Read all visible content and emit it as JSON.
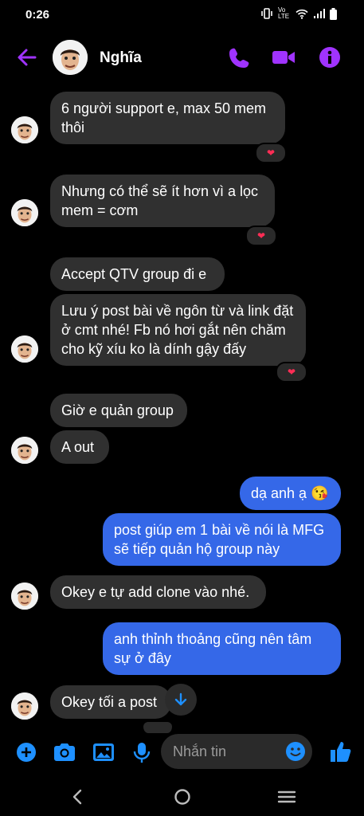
{
  "status": {
    "time": "0:26",
    "network": "Vo LTE"
  },
  "header": {
    "contact_name": "Nghĩa"
  },
  "messages": [
    {
      "text": "6 người support e, max 50 mem thôi"
    },
    {
      "text": "Nhưng có thể sẽ ít hơn vì a lọc mem = cơm"
    },
    {
      "text": "Accept QTV group đi e"
    },
    {
      "text": "Lưu ý post bài về ngôn từ và link đặt ở cmt nhé! Fb nó hơi gắt nên chăm cho kỹ xíu ko là dính gậy đấy"
    },
    {
      "text": "Giờ e quản group"
    },
    {
      "text": "A out"
    },
    {
      "text": "dạ anh ạ 😘"
    },
    {
      "text": "post giúp em 1 bài về nói là MFG sẽ tiếp quản hộ group này"
    },
    {
      "text": "Okey e tự add clone vào nhé."
    },
    {
      "text": "anh thỉnh thoảng cũng nên tâm sự ở đây"
    },
    {
      "text": "Okey tối a post"
    }
  ],
  "reaction": "❤",
  "composer": {
    "placeholder": "Nhắn tin"
  },
  "colors": {
    "accent": "#a033ff",
    "outgoing": "#3568e8",
    "incoming": "#303030",
    "icon_blue": "#1e90ff"
  },
  "icons": [
    "back-arrow",
    "phone",
    "video-camera",
    "info",
    "plus",
    "camera",
    "image",
    "microphone",
    "emoji",
    "thumbs-up",
    "chevron-down"
  ]
}
